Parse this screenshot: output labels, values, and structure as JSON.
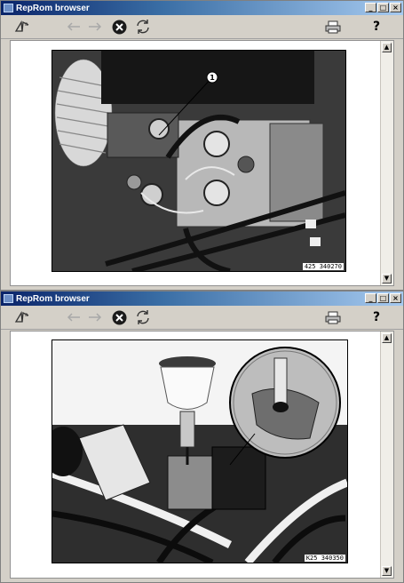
{
  "windows": [
    {
      "title": "RepRom browser",
      "controls": {
        "minimize": "_",
        "maximize": "□",
        "close": "×"
      },
      "toolbar": {
        "help_label": "?"
      },
      "figure": {
        "callout": "1",
        "code": "425 340270"
      }
    },
    {
      "title": "RepRom browser",
      "controls": {
        "minimize": "_",
        "maximize": "□",
        "close": "×"
      },
      "toolbar": {
        "help_label": "?"
      },
      "figure": {
        "callout": "",
        "code": "K25 340350"
      }
    }
  ],
  "icons": [
    "book-icon",
    "back-arrow-icon",
    "forward-arrow-icon",
    "stop-icon",
    "refresh-icon",
    "print-icon",
    "help-icon"
  ],
  "colors": {
    "titlebar_start": "#0a246a",
    "titlebar_end": "#a6caf0",
    "window_face": "#d4d0c8"
  }
}
